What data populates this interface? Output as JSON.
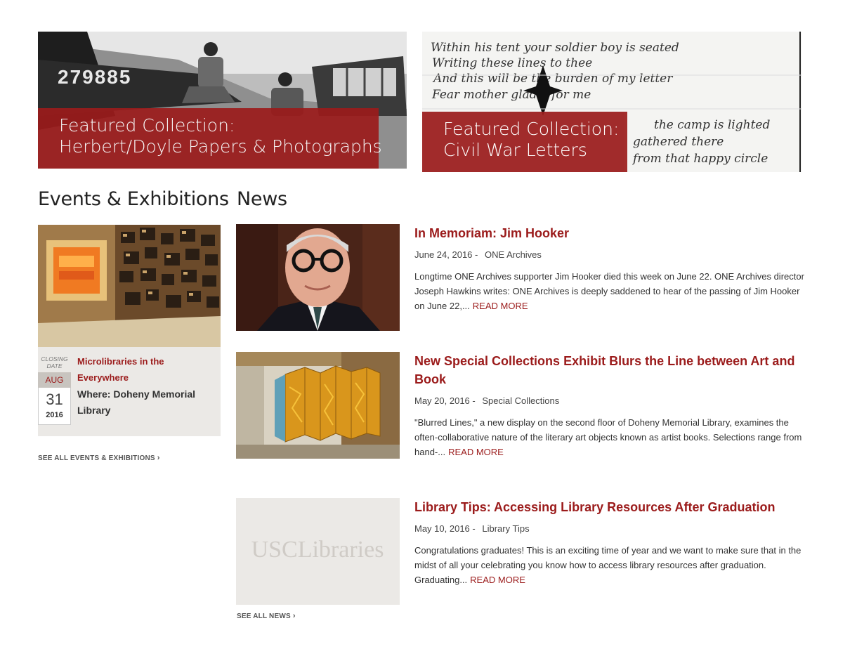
{
  "featured": [
    {
      "label": "Featured Collection:",
      "title": "Herbert/Doyle Papers & Photographs",
      "plane_number": "279885"
    },
    {
      "label": "Featured Collection:",
      "title": "Civil War Letters",
      "handwriting": [
        "Within his tent your soldier boy is seated",
        "Writing these lines to thee",
        "And this will be the burden of my letter",
        "Fear mother gladly for me",
        "the camp is lighted",
        "gathered there",
        "from that happy circle"
      ]
    }
  ],
  "events": {
    "section_title": "Events & Exhibitions",
    "card": {
      "closing_label": "CLOSING DATE",
      "month": "AUG",
      "day": "31",
      "year": "2016",
      "title": "Microlibraries in the Everywhere",
      "where": "Where: Doheny Memorial Library"
    },
    "see_all": "SEE ALL EVENTS & EXHIBITIONS",
    "see_all_chevron": "›"
  },
  "news": {
    "section_title": "News",
    "items": [
      {
        "title": "In Memoriam: Jim Hooker",
        "date": "June 24, 2016",
        "separator": "-",
        "category": "ONE Archives",
        "excerpt": "Longtime ONE Archives supporter Jim Hooker died this week on June 22. ONE Archives director Joseph Hawkins writes: ONE Archives is deeply saddened to hear of the passing of Jim Hooker on June 22,...",
        "read_more": "READ MORE"
      },
      {
        "title": "New Special Collections Exhibit Blurs the Line between Art and Book",
        "date": "May 20, 2016",
        "separator": "-",
        "category": "Special Collections",
        "excerpt": "\"Blurred Lines,\" a new display on the second floor of Doheny Memorial Library, examines the often-collaborative nature of the literary art objects known as artist books. Selections range from hand-...",
        "read_more": "READ MORE"
      },
      {
        "title": "Library Tips: Accessing Library Resources After Graduation",
        "date": "May 10, 2016",
        "separator": "-",
        "category": "Library Tips",
        "excerpt": "Congratulations graduates! This is an exciting time of year and we want to make sure that in the midst of all your celebrating you know how to access library resources after graduation. Graduating...",
        "read_more": "READ MORE",
        "thumb_logo": "USCLibraries"
      }
    ],
    "see_all": "SEE ALL NEWS",
    "see_all_chevron": "›"
  },
  "colors": {
    "brand_red": "#9b1b1b",
    "card_bg": "#ebe9e6"
  }
}
